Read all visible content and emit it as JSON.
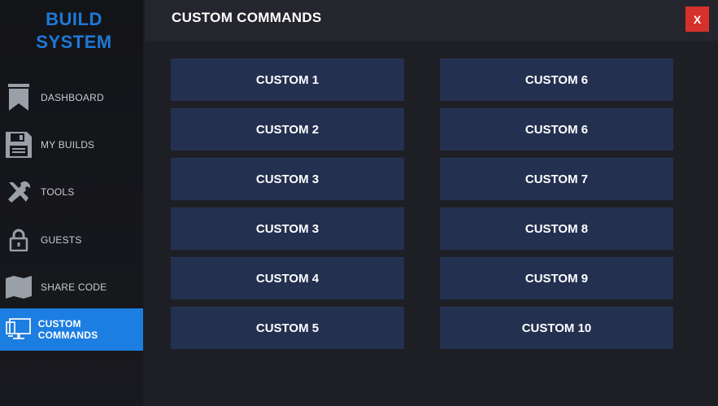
{
  "brand": {
    "line1": "BUILD",
    "line2": "SYSTEM",
    "color": "#1e78d8"
  },
  "sidebar": {
    "items": [
      {
        "label": "DASHBOARD",
        "icon": "bookmark-icon"
      },
      {
        "label": "MY BUILDS",
        "icon": "floppy-disk-icon"
      },
      {
        "label": "TOOLS",
        "icon": "tools-icon"
      },
      {
        "label": "GUESTS",
        "icon": "lock-icon"
      },
      {
        "label": "SHARE CODE",
        "icon": "map-icon"
      },
      {
        "label": "CUSTOM COMMANDS",
        "icon": "monitor-icon",
        "active": true
      }
    ],
    "active_color": "#1c7ee0"
  },
  "header": {
    "title": "CUSTOM COMMANDS",
    "close_label": "X",
    "close_color": "#d6302c"
  },
  "commands": {
    "left": [
      "CUSTOM 1",
      "CUSTOM 2",
      "CUSTOM 3",
      "CUSTOM 3",
      "CUSTOM 4",
      "CUSTOM 5"
    ],
    "right": [
      "CUSTOM 6",
      "CUSTOM 6",
      "CUSTOM 7",
      "CUSTOM 8",
      "CUSTOM 9",
      "CUSTOM 10"
    ],
    "button_color": "#233050"
  }
}
